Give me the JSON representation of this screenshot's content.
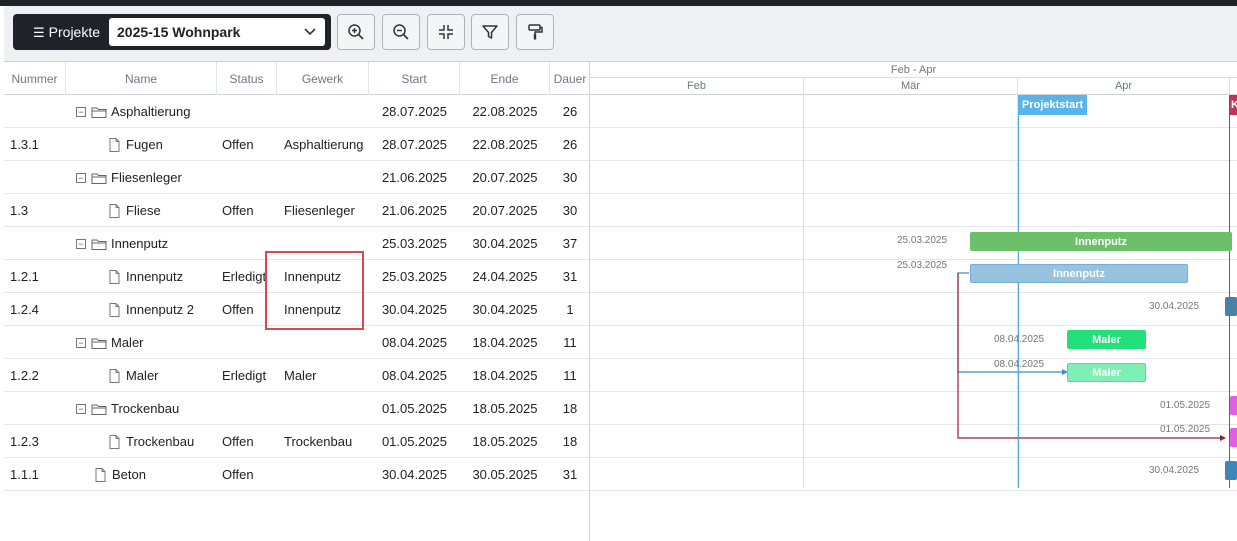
{
  "toolbar": {
    "projects_label": "Projekte",
    "project_selected": "2025-15 Wohnpark",
    "buttons": [
      "zoom-in-icon",
      "zoom-out-icon",
      "collapse-icon",
      "filter-icon",
      "paint-roller-icon"
    ]
  },
  "grid": {
    "headers": {
      "nummer": "Nummer",
      "name": "Name",
      "status": "Status",
      "gewerk": "Gewerk",
      "start": "Start",
      "ende": "Ende",
      "dauer": "Dauer"
    },
    "rows": [
      {
        "nummer": "",
        "name": "Asphaltierung",
        "status": "",
        "gewerk": "",
        "start": "28.07.2025",
        "ende": "22.08.2025",
        "dauer": "26",
        "type": "group"
      },
      {
        "nummer": "1.3.1",
        "name": "Fugen",
        "status": "Offen",
        "gewerk": "Asphaltierung",
        "start": "28.07.2025",
        "ende": "22.08.2025",
        "dauer": "26",
        "type": "task"
      },
      {
        "nummer": "",
        "name": "Fliesenleger",
        "status": "",
        "gewerk": "",
        "start": "21.06.2025",
        "ende": "20.07.2025",
        "dauer": "30",
        "type": "group"
      },
      {
        "nummer": "1.3",
        "name": "Fliese",
        "status": "Offen",
        "gewerk": "Fliesenleger",
        "start": "21.06.2025",
        "ende": "20.07.2025",
        "dauer": "30",
        "type": "task"
      },
      {
        "nummer": "",
        "name": "Innenputz",
        "status": "",
        "gewerk": "",
        "start": "25.03.2025",
        "ende": "30.04.2025",
        "dauer": "37",
        "type": "group"
      },
      {
        "nummer": "1.2.1",
        "name": "Innenputz",
        "status": "Erledigt",
        "gewerk": "Innenputz",
        "start": "25.03.2025",
        "ende": "24.04.2025",
        "dauer": "31",
        "type": "task"
      },
      {
        "nummer": "1.2.4",
        "name": "Innenputz 2",
        "status": "Offen",
        "gewerk": "Innenputz",
        "start": "30.04.2025",
        "ende": "30.04.2025",
        "dauer": "1",
        "type": "task"
      },
      {
        "nummer": "",
        "name": "Maler",
        "status": "",
        "gewerk": "",
        "start": "08.04.2025",
        "ende": "18.04.2025",
        "dauer": "11",
        "type": "group"
      },
      {
        "nummer": "1.2.2",
        "name": "Maler",
        "status": "Erledigt",
        "gewerk": "Maler",
        "start": "08.04.2025",
        "ende": "18.04.2025",
        "dauer": "11",
        "type": "task"
      },
      {
        "nummer": "",
        "name": "Trockenbau",
        "status": "",
        "gewerk": "",
        "start": "01.05.2025",
        "ende": "18.05.2025",
        "dauer": "18",
        "type": "group"
      },
      {
        "nummer": "1.2.3",
        "name": "Trockenbau",
        "status": "Offen",
        "gewerk": "Trockenbau",
        "start": "01.05.2025",
        "ende": "18.05.2025",
        "dauer": "18",
        "type": "task"
      },
      {
        "nummer": "1.1.1",
        "name": "Beton",
        "status": "Offen",
        "gewerk": "",
        "start": "30.04.2025",
        "ende": "30.05.2025",
        "dauer": "31",
        "type": "task-root"
      }
    ]
  },
  "gantt": {
    "range_label": "Feb - Apr",
    "months": [
      "Feb",
      "Mär",
      "Apr"
    ],
    "marker_projektstart": "Projektstart",
    "marker_red_initial": "K",
    "bars": {
      "innenputz_group": {
        "label": "Innenputz",
        "date": "25.03.2025",
        "color": "#6cc06a"
      },
      "innenputz_task": {
        "label": "Innenputz",
        "date": "25.03.2025",
        "color": "#96c4e0"
      },
      "innenputz2": {
        "date": "30.04.2025",
        "color": "#4a7fa6"
      },
      "maler_group": {
        "label": "Maler",
        "date": "08.04.2025",
        "color": "#22e07a"
      },
      "maler_task": {
        "label": "Maler",
        "date": "08.04.2025",
        "color": "#7ef0b4"
      },
      "trockenbau_group": {
        "date": "01.05.2025",
        "color": "#e35ee6"
      },
      "trockenbau_task": {
        "date": "01.05.2025",
        "color": "#e35ee6"
      },
      "beton": {
        "date": "30.04.2025",
        "color": "#3d86b8"
      }
    }
  }
}
